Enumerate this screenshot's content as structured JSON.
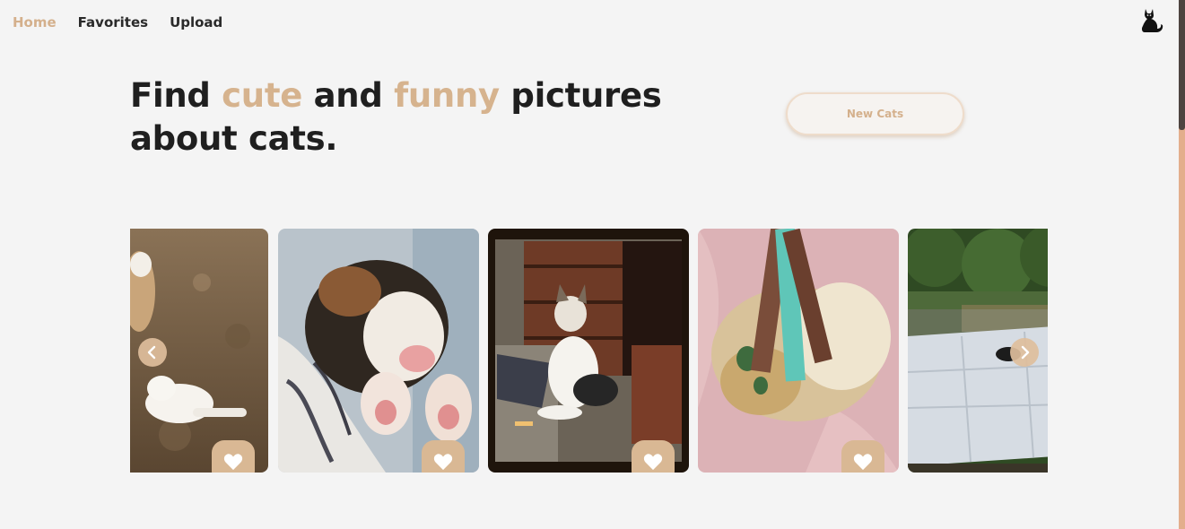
{
  "nav": {
    "items": [
      {
        "label": "Home",
        "active": true
      },
      {
        "label": "Favorites",
        "active": false
      },
      {
        "label": "Upload",
        "active": false
      }
    ]
  },
  "logo_icon": "black-cat-icon",
  "hero": {
    "parts": [
      {
        "text": "Find ",
        "highlight": false
      },
      {
        "text": "cute",
        "highlight": true
      },
      {
        "text": " and ",
        "highlight": false
      },
      {
        "text": "funny",
        "highlight": true
      },
      {
        "text": " pictures about cats.",
        "highlight": false
      }
    ],
    "button_label": "New Cats"
  },
  "carousel": {
    "cards": [
      {
        "name": "cat-card-1",
        "desc_icon": "cat-photo",
        "favorite_icon": "heart-icon"
      },
      {
        "name": "cat-card-2",
        "desc_icon": "cat-photo",
        "favorite_icon": "heart-icon"
      },
      {
        "name": "cat-card-3",
        "desc_icon": "cat-photo",
        "favorite_icon": "heart-icon"
      },
      {
        "name": "cat-card-4",
        "desc_icon": "cat-photo",
        "favorite_icon": "heart-icon"
      },
      {
        "name": "cat-card-5",
        "desc_icon": "cat-photo",
        "favorite_icon": "heart-icon"
      }
    ],
    "prev_icon": "chevron-left-icon",
    "next_icon": "chevron-right-icon"
  },
  "colors": {
    "accent": "#d6b38e",
    "background": "#f4f4f4",
    "text": "#1f1f1f",
    "heart_button": "#d9b894"
  }
}
